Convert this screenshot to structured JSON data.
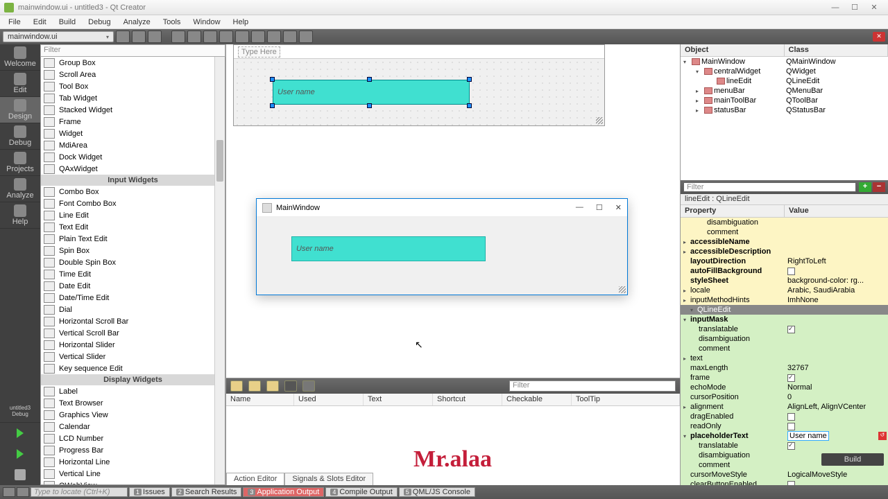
{
  "titlebar": {
    "text": "mainwindow.ui - untitled3 - Qt Creator"
  },
  "menubar": [
    "File",
    "Edit",
    "Build",
    "Debug",
    "Analyze",
    "Tools",
    "Window",
    "Help"
  ],
  "open_file": "mainwindow.ui",
  "sidebar": {
    "items": [
      "Welcome",
      "Edit",
      "Design",
      "Debug",
      "Projects",
      "Analyze",
      "Help"
    ],
    "active": 2,
    "bottom_label1": "untitled3",
    "bottom_label2": "Debug"
  },
  "widget_box": {
    "filter": "Filter",
    "rows": [
      {
        "t": "Group Box"
      },
      {
        "t": "Scroll Area"
      },
      {
        "t": "Tool Box"
      },
      {
        "t": "Tab Widget"
      },
      {
        "t": "Stacked Widget"
      },
      {
        "t": "Frame"
      },
      {
        "t": "Widget"
      },
      {
        "t": "MdiArea"
      },
      {
        "t": "Dock Widget"
      },
      {
        "t": "QAxWidget"
      },
      {
        "cat": "Input Widgets"
      },
      {
        "t": "Combo Box"
      },
      {
        "t": "Font Combo Box"
      },
      {
        "t": "Line Edit"
      },
      {
        "t": "Text Edit"
      },
      {
        "t": "Plain Text Edit"
      },
      {
        "t": "Spin Box"
      },
      {
        "t": "Double Spin Box"
      },
      {
        "t": "Time Edit"
      },
      {
        "t": "Date Edit"
      },
      {
        "t": "Date/Time Edit"
      },
      {
        "t": "Dial"
      },
      {
        "t": "Horizontal Scroll Bar"
      },
      {
        "t": "Vertical Scroll Bar"
      },
      {
        "t": "Horizontal Slider"
      },
      {
        "t": "Vertical Slider"
      },
      {
        "t": "Key sequence Edit"
      },
      {
        "cat": "Display Widgets"
      },
      {
        "t": "Label"
      },
      {
        "t": "Text Browser"
      },
      {
        "t": "Graphics View"
      },
      {
        "t": "Calendar"
      },
      {
        "t": "LCD Number"
      },
      {
        "t": "Progress Bar"
      },
      {
        "t": "Horizontal Line"
      },
      {
        "t": "Vertical Line"
      },
      {
        "t": "QWebView"
      }
    ]
  },
  "designer": {
    "type_here": "Type Here",
    "placeholder": "User name"
  },
  "preview": {
    "title": "MainWindow",
    "placeholder": "User name"
  },
  "watermark": "Mr.alaa",
  "object_inspector": {
    "headers": [
      "Object",
      "Class"
    ],
    "rows": [
      {
        "lvl": 0,
        "name": "MainWindow",
        "cls": "QMainWindow",
        "exp": true
      },
      {
        "lvl": 1,
        "name": "centralWidget",
        "cls": "QWidget",
        "exp": true
      },
      {
        "lvl": 2,
        "name": "lineEdit",
        "cls": "QLineEdit",
        "sel": true
      },
      {
        "lvl": 1,
        "name": "menuBar",
        "cls": "QMenuBar"
      },
      {
        "lvl": 1,
        "name": "mainToolBar",
        "cls": "QToolBar"
      },
      {
        "lvl": 1,
        "name": "statusBar",
        "cls": "QStatusBar"
      }
    ]
  },
  "property_editor": {
    "filter": "Filter",
    "crumb": "lineEdit : QLineEdit",
    "headers": [
      "Property",
      "Value"
    ],
    "rows": [
      {
        "lvl": 2,
        "p": "disambiguation",
        "v": "",
        "bg": "y"
      },
      {
        "lvl": 2,
        "p": "comment",
        "v": "",
        "bg": "y"
      },
      {
        "lvl": 0,
        "p": "accessibleName",
        "v": "",
        "bg": "y",
        "arrow": ">",
        "bold": true
      },
      {
        "lvl": 0,
        "p": "accessibleDescription",
        "v": "",
        "bg": "y",
        "arrow": ">",
        "bold": true
      },
      {
        "lvl": 0,
        "p": "layoutDirection",
        "v": "RightToLeft",
        "bg": "y",
        "bold": true
      },
      {
        "lvl": 0,
        "p": "autoFillBackground",
        "v": "",
        "bg": "y",
        "check": false,
        "bold": true
      },
      {
        "lvl": 0,
        "p": "styleSheet",
        "v": "background-color: rg...",
        "bg": "y",
        "bold": true
      },
      {
        "lvl": 0,
        "p": "locale",
        "v": "Arabic, SaudiArabia",
        "bg": "y",
        "arrow": ">"
      },
      {
        "lvl": 0,
        "p": "inputMethodHints",
        "v": "ImhNone",
        "bg": "y",
        "arrow": ">"
      },
      {
        "section": "QLineEdit"
      },
      {
        "lvl": 0,
        "p": "inputMask",
        "v": "",
        "bg": "g",
        "arrow": "v",
        "bold": true
      },
      {
        "lvl": 1,
        "p": "translatable",
        "v": "",
        "bg": "g",
        "check": true
      },
      {
        "lvl": 1,
        "p": "disambiguation",
        "v": "",
        "bg": "g"
      },
      {
        "lvl": 1,
        "p": "comment",
        "v": "",
        "bg": "g"
      },
      {
        "lvl": 0,
        "p": "text",
        "v": "",
        "bg": "g",
        "arrow": ">"
      },
      {
        "lvl": 0,
        "p": "maxLength",
        "v": "32767",
        "bg": "g"
      },
      {
        "lvl": 0,
        "p": "frame",
        "v": "",
        "bg": "g",
        "check": true
      },
      {
        "lvl": 0,
        "p": "echoMode",
        "v": "Normal",
        "bg": "g"
      },
      {
        "lvl": 0,
        "p": "cursorPosition",
        "v": "0",
        "bg": "g"
      },
      {
        "lvl": 0,
        "p": "alignment",
        "v": "AlignLeft, AlignVCenter",
        "bg": "g",
        "arrow": ">"
      },
      {
        "lvl": 0,
        "p": "dragEnabled",
        "v": "",
        "bg": "g",
        "check": false
      },
      {
        "lvl": 0,
        "p": "readOnly",
        "v": "",
        "bg": "g",
        "check": false
      },
      {
        "lvl": 0,
        "p": "placeholderText",
        "v": "User name",
        "bg": "g",
        "arrow": "v",
        "bold": true,
        "edit": true
      },
      {
        "lvl": 1,
        "p": "translatable",
        "v": "",
        "bg": "g",
        "check": true
      },
      {
        "lvl": 1,
        "p": "disambiguation",
        "v": "",
        "bg": "g"
      },
      {
        "lvl": 1,
        "p": "comment",
        "v": "",
        "bg": "g"
      },
      {
        "lvl": 0,
        "p": "cursorMoveStyle",
        "v": "LogicalMoveStyle",
        "bg": "g"
      },
      {
        "lvl": 0,
        "p": "clearButtonEnabled",
        "v": "",
        "bg": "g",
        "check": false
      }
    ]
  },
  "build_btn": "Build",
  "action_editor": {
    "filter": "Filter",
    "headers": [
      "Name",
      "Used",
      "Text",
      "Shortcut",
      "Checkable",
      "ToolTip"
    ],
    "tabs": [
      "Action Editor",
      "Signals & Slots Editor"
    ]
  },
  "status": {
    "locator": "Type to locate (Ctrl+K)",
    "tabs": [
      {
        "n": "1",
        "t": "Issues"
      },
      {
        "n": "2",
        "t": "Search Results"
      },
      {
        "n": "3",
        "t": "Application Output",
        "active": true
      },
      {
        "n": "4",
        "t": "Compile Output"
      },
      {
        "n": "5",
        "t": "QML/JS Console"
      }
    ]
  }
}
